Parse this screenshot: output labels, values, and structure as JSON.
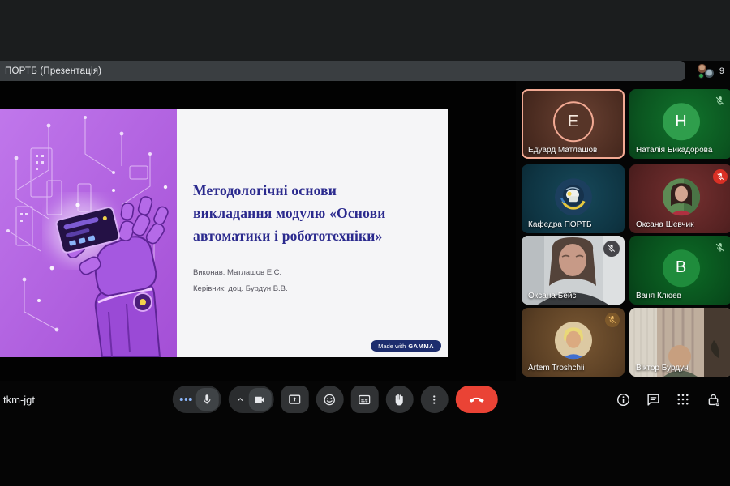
{
  "top_bar": {
    "title": "ПОРТБ (Презентація)",
    "participant_count": "9"
  },
  "presentation": {
    "slide": {
      "title_line1": "Методологічні основи",
      "title_line2": "викладання модулю «Основи",
      "title_line3": "автоматики і робототехніки»",
      "author": "Виконав: Матлашов Е.С.",
      "supervisor": "Керівник: доц. Бурдун В.В.",
      "badge_prefix": "Made with",
      "badge_brand": "GAMMA"
    }
  },
  "participants": [
    {
      "name": "Едуард Матлашов",
      "initial": "Е",
      "avatar": "letter",
      "speaking": true,
      "muted": false
    },
    {
      "name": "Наталія Бикадорова",
      "initial": "Н",
      "avatar": "letter",
      "speaking": false,
      "muted": true
    },
    {
      "name": "Кафедра ПОРТБ",
      "avatar": "logo",
      "speaking": false,
      "muted": false
    },
    {
      "name": "Оксана Шевчик",
      "avatar": "photo",
      "speaking": false,
      "muted": true
    },
    {
      "name": "Оксана Бейс",
      "avatar": "video",
      "speaking": false,
      "muted": true
    },
    {
      "name": "Ваня Клюев",
      "initial": "В",
      "avatar": "letter",
      "speaking": false,
      "muted": true
    },
    {
      "name": "Artem Troshchii",
      "avatar": "photo",
      "speaking": false,
      "muted": true
    },
    {
      "name": "Віктор Бурдун",
      "avatar": "video",
      "speaking": false,
      "muted": false
    }
  ],
  "toolbar": {
    "meeting_code": "tkm-jgt",
    "buttons": [
      "microphone",
      "camera",
      "present-screen",
      "reactions",
      "captions",
      "raise-hand",
      "more-options",
      "end-call"
    ],
    "right_buttons": [
      "meeting-details",
      "chat",
      "activities",
      "host-controls"
    ]
  },
  "icons": {
    "mic_off": "mic-off-icon",
    "mic": "mic-icon",
    "camera": "camera-icon",
    "chevron_up": "chevron-up-icon",
    "present": "present-screen-icon",
    "reactions": "smiley-icon",
    "captions": "cc-icon",
    "raise_hand": "hand-icon",
    "more_options": "⋮",
    "end_call": "phone-hangup-icon",
    "info": "info-icon",
    "chat": "chat-bubble-icon",
    "apps": "grid-dots-icon",
    "lock": "lock-gear-icon"
  },
  "colors": {
    "end_call_red": "#ea4335",
    "speaking_border": "#f2a993",
    "muted_badge_red": "#d93025",
    "audio_activity_blue": "#8ab4f8",
    "top_bar_gray": "#3a3e41",
    "control_gray": "#303234",
    "slide_purple": "#b264e3",
    "slide_title_indigo": "#2b2a8e",
    "gamma_badge_navy": "#1d2d6e",
    "tile_brown": "#4a2b20",
    "tile_green": "#0b5520",
    "tile_teal": "#0e3442",
    "tile_red": "#562222",
    "tile_tan": "#5a3f24"
  }
}
